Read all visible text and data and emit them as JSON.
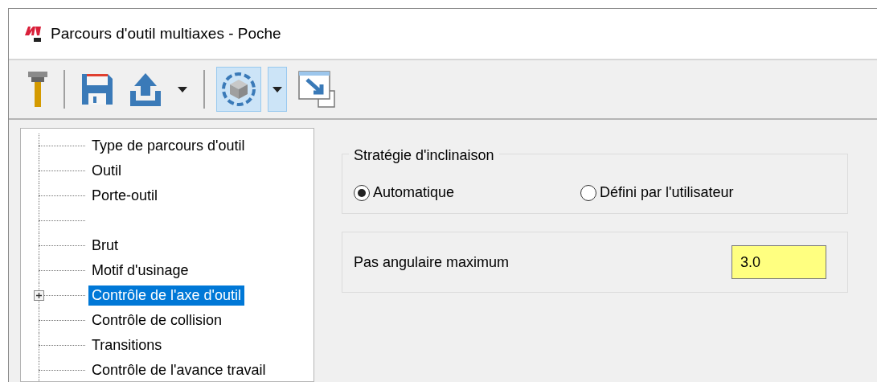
{
  "window": {
    "title": "Parcours d'outil multiaxes - Poche"
  },
  "toolbar": [
    {
      "kind": "tool",
      "pressed": false
    },
    {
      "kind": "separator"
    },
    {
      "kind": "save",
      "pressed": false
    },
    {
      "kind": "upload",
      "pressed": false,
      "dropdown": true
    },
    {
      "kind": "separator"
    },
    {
      "kind": "view",
      "pressed": true,
      "dropdown": true
    },
    {
      "kind": "window",
      "pressed": false
    }
  ],
  "tree": {
    "items": [
      {
        "label": "Type de parcours d'outil",
        "selected": false,
        "expandable": false
      },
      {
        "label": "Outil",
        "selected": false,
        "expandable": false
      },
      {
        "label": "Porte-outil",
        "selected": false,
        "expandable": false
      },
      {
        "selected": false,
        "expandable": false
      },
      {
        "label": "Brut",
        "selected": false,
        "expandable": false
      },
      {
        "label": "Motif d'usinage",
        "selected": false,
        "expandable": false
      },
      {
        "label": "Contrôle de l'axe d'outil",
        "selected": true,
        "expandable": true
      },
      {
        "label": "Contrôle de collision",
        "selected": false,
        "expandable": false
      },
      {
        "label": "Transitions",
        "selected": false,
        "expandable": false
      },
      {
        "label": "Contrôle de l'avance travail",
        "selected": false,
        "expandable": false
      }
    ]
  },
  "tilt_strategy": {
    "title": "Stratégie d'inclinaison",
    "options": [
      {
        "label": "Automatique",
        "selected": true
      },
      {
        "label": "Défini par l'utilisateur",
        "selected": false
      }
    ]
  },
  "angular_step": {
    "label": "Pas angulaire maximum",
    "value": "3.0"
  }
}
